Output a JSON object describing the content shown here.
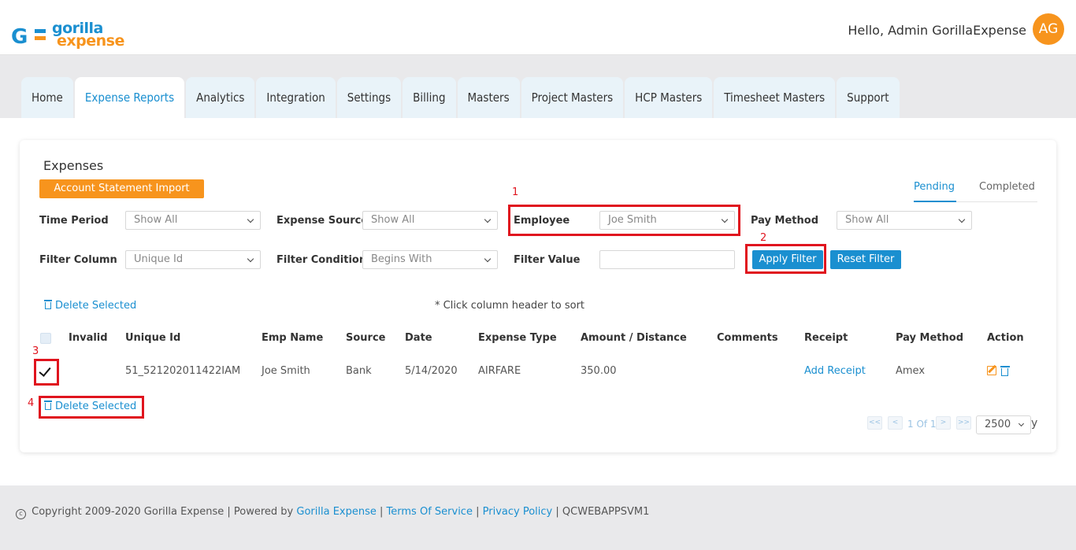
{
  "header": {
    "logo_line1": "gorilla",
    "logo_line2": "expense",
    "greeting": "Hello, Admin GorillaExpense",
    "avatar_initials": "AG"
  },
  "nav": {
    "tabs": [
      "Home",
      "Expense Reports",
      "Analytics",
      "Integration",
      "Settings",
      "Billing",
      "Masters",
      "Project Masters",
      "HCP Masters",
      "Timesheet Masters",
      "Support"
    ],
    "active": "Expense Reports"
  },
  "page": {
    "title": "Expenses",
    "import_button": "Account Statement Import",
    "status_tabs": [
      "Pending",
      "Completed"
    ],
    "active_status": "Pending"
  },
  "filters": {
    "time_period_label": "Time Period",
    "time_period_value": "Show All",
    "expense_source_label": "Expense Source",
    "expense_source_value": "Show All",
    "employee_label": "Employee",
    "employee_value": "Joe Smith",
    "pay_method_label": "Pay Method",
    "pay_method_value": "Show All",
    "filter_column_label": "Filter Column",
    "filter_column_value": "Unique Id",
    "filter_condition_label": "Filter Condition",
    "filter_condition_value": "Begins With",
    "filter_value_label": "Filter Value",
    "filter_value": "",
    "apply_button": "Apply Filter",
    "reset_button": "Reset Filter"
  },
  "table": {
    "delete_selected": "Delete Selected",
    "sort_hint": "* Click column header to sort",
    "columns": [
      "Invalid",
      "Unique Id",
      "Emp Name",
      "Source",
      "Date",
      "Expense Type",
      "Amount / Distance",
      "Comments",
      "Receipt",
      "Pay Method",
      "Action"
    ],
    "rows": [
      {
        "checked": true,
        "invalid": "",
        "unique_id": "51_521202011422IAM",
        "emp_name": "Joe Smith",
        "source": "Bank",
        "date": "5/14/2020",
        "expense_type": "AIRFARE",
        "amount": "350.00",
        "comments": "",
        "receipt": "Add Receipt",
        "pay_method": "Amex"
      }
    ]
  },
  "pagination": {
    "first": "<<",
    "prev": "<",
    "page_text": "1 Of 1",
    "next": ">",
    "last": ">>",
    "page_size": "2500",
    "trailing": "y"
  },
  "annotations": {
    "label_1": "1",
    "label_2": "2",
    "label_3": "3",
    "label_4": "4",
    "color": "#e0141e"
  },
  "footer": {
    "copyright_symbol": "c",
    "text_before": "Copyright 2009-2020 Gorilla Expense | Powered by",
    "powered_link": "Gorilla Expense",
    "sep1": "|",
    "terms_link": "Terms Of Service",
    "sep2": "|",
    "privacy_link": "Privacy Policy",
    "sep3": "|",
    "server": "QCWEBAPPSVM1"
  },
  "colors": {
    "brand_blue": "#1a8fd0",
    "brand_orange": "#f7941d"
  }
}
